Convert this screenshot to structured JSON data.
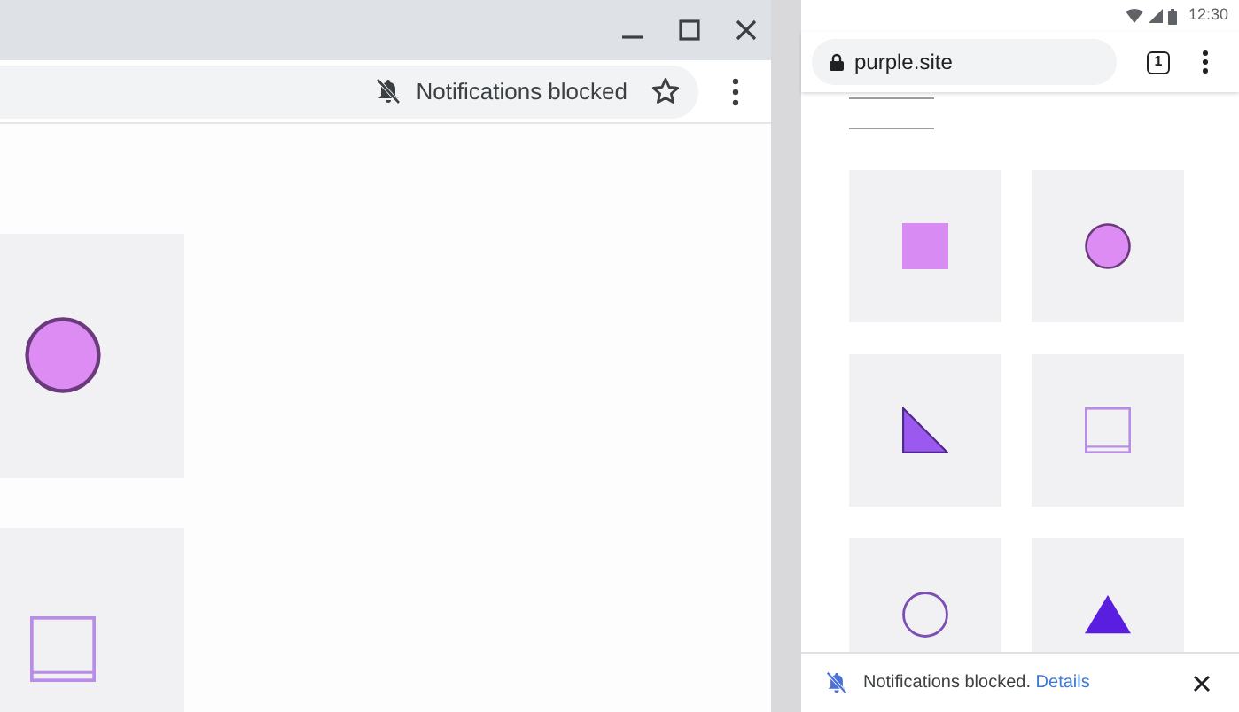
{
  "desktop_window": {
    "omnibox": {
      "notification_chip": "Notifications blocked",
      "bookmarked": false
    },
    "tiles": [
      {
        "kind": "circle"
      },
      {
        "kind": "outline-square"
      }
    ]
  },
  "phone": {
    "status_bar": {
      "time": "12:30"
    },
    "url": "purple.site",
    "tab_count": "1",
    "tiles": [
      {
        "kind": "square"
      },
      {
        "kind": "circle"
      },
      {
        "kind": "triangle"
      },
      {
        "kind": "outline-square"
      },
      {
        "kind": "outline-circle"
      },
      {
        "kind": "triangle-up"
      }
    ],
    "infobar": {
      "message": "Notifications blocked.",
      "link": "Details"
    }
  }
}
